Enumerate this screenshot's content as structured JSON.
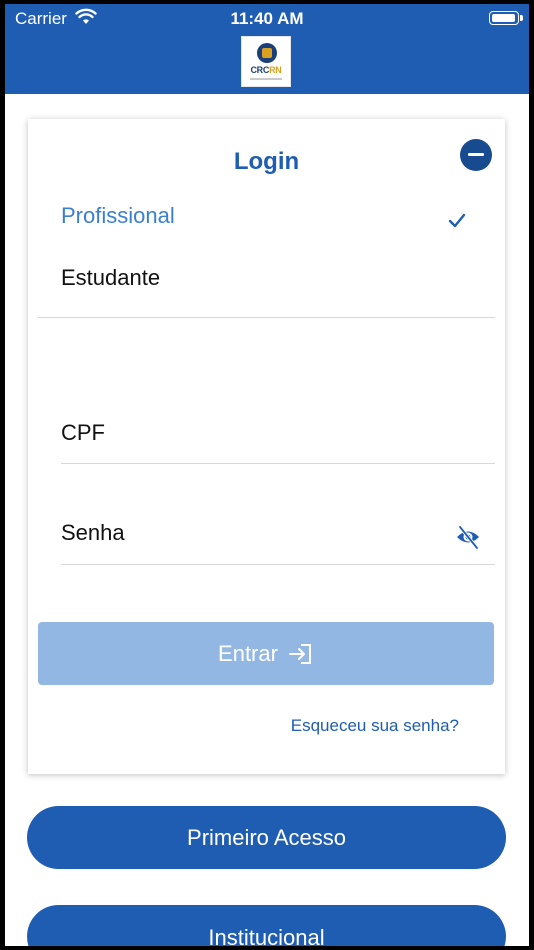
{
  "status_bar": {
    "carrier": "Carrier",
    "time": "11:40 AM"
  },
  "logo": {
    "text_left": "CRC",
    "text_right": "RN"
  },
  "login_card": {
    "title": "Login",
    "options": [
      {
        "label": "Profissional",
        "selected": true
      },
      {
        "label": "Estudante",
        "selected": false
      }
    ],
    "cpf_label": "CPF",
    "senha_label": "Senha",
    "submit_label": "Entrar",
    "forgot_label": "Esqueceu sua senha?"
  },
  "buttons": {
    "first_access": "Primeiro Acesso",
    "institutional": "Institucional"
  },
  "colors": {
    "brand_blue": "#1f5db2",
    "disabled_blue": "#93b7e3",
    "selected_text": "#3a7fd0"
  }
}
